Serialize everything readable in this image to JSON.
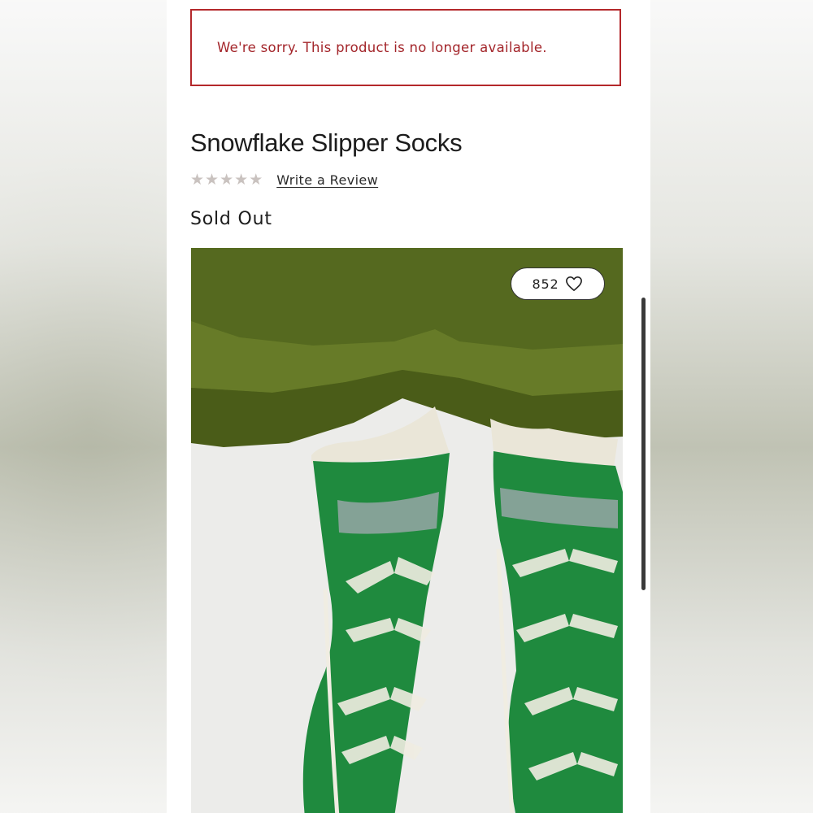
{
  "alert": {
    "message": "We're sorry. This product is no longer available."
  },
  "product": {
    "title": "Snowflake Slipper Socks",
    "rating_stars": 0,
    "review_link": "Write a Review",
    "status": "Sold Out",
    "favorites_count": "852"
  },
  "icons": {
    "star": "star-icon",
    "heart": "heart-outline-icon"
  },
  "colors": {
    "alert_border": "#b4282b",
    "alert_text": "#a3252a",
    "star_empty": "#c9c2bf"
  }
}
